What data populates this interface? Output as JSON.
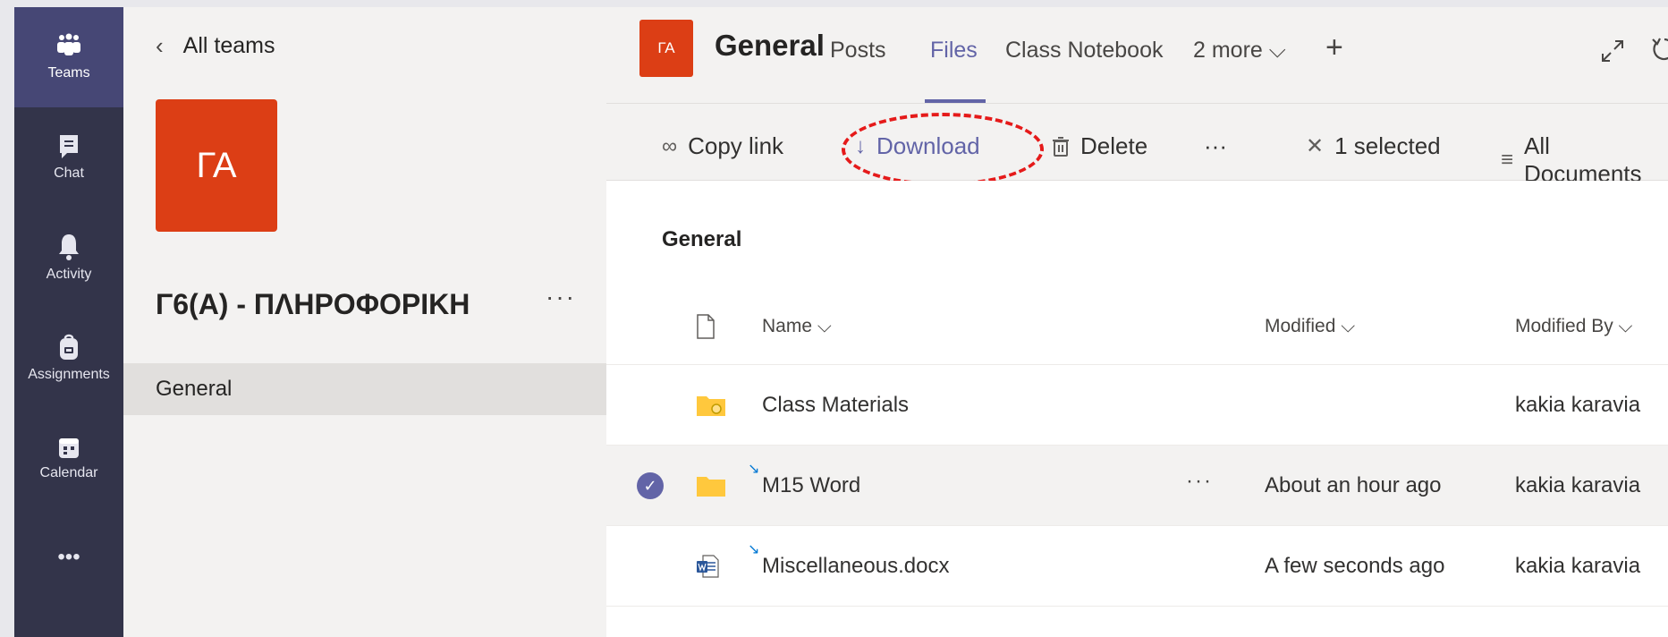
{
  "rail": {
    "items": [
      {
        "label": "Teams"
      },
      {
        "label": "Chat"
      },
      {
        "label": "Activity"
      },
      {
        "label": "Assignments"
      },
      {
        "label": "Calendar"
      }
    ],
    "more": "•••"
  },
  "team": {
    "back_label": "All teams",
    "avatar_initials": "ΓΑ",
    "name": "Γ6(Α) - ΠΛΗΡΟΦΟΡΙΚΗ",
    "more": "···",
    "channels": [
      {
        "label": "General"
      }
    ]
  },
  "header": {
    "avatar_initials": "ΓΑ",
    "channel_title": "General",
    "tabs": [
      {
        "label": "Posts"
      },
      {
        "label": "Files"
      },
      {
        "label": "Class Notebook"
      },
      {
        "label": "2 more ⌵"
      }
    ],
    "add_tab": "+"
  },
  "commands": {
    "copy_link": "Copy link",
    "download": "Download",
    "delete": "Delete",
    "more": "···",
    "selected": "1 selected",
    "view": "All Documents"
  },
  "files": {
    "breadcrumb": "General",
    "columns": {
      "name": "Name ⌵",
      "modified": "Modified ⌵",
      "modified_by": "Modified By ⌵"
    },
    "rows": [
      {
        "name": "Class Materials",
        "modified": "",
        "modified_by": "kakia karavia"
      },
      {
        "name": "M15 Word",
        "modified": "About an hour ago",
        "modified_by": "kakia karavia",
        "more": "···"
      },
      {
        "name": "Miscellaneous.docx",
        "modified": "A few seconds ago",
        "modified_by": "kakia karavia"
      }
    ]
  },
  "colors": {
    "rail_bg": "#33344a",
    "accent": "#6264a7",
    "team_orange": "#dc3e15",
    "highlight_red": "#e51a1a"
  }
}
